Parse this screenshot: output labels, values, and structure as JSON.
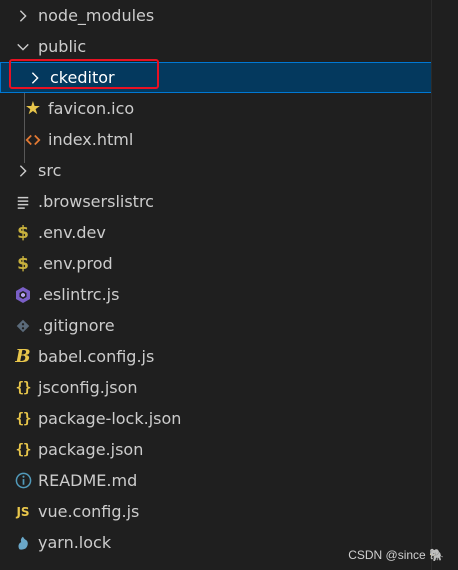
{
  "explorer": {
    "items": [
      {
        "label": "node_modules",
        "kind": "folder",
        "state": "collapsed",
        "level": 0,
        "icon": "chevron-right-icon"
      },
      {
        "label": "public",
        "kind": "folder",
        "state": "expanded",
        "level": 0,
        "icon": "chevron-down-icon"
      },
      {
        "label": "ckeditor",
        "kind": "folder",
        "state": "collapsed",
        "level": 1,
        "icon": "chevron-right-icon",
        "selected": true
      },
      {
        "label": "favicon.ico",
        "kind": "file",
        "level": 1,
        "icon": "star-icon"
      },
      {
        "label": "index.html",
        "kind": "file",
        "level": 1,
        "icon": "code-brackets-icon"
      },
      {
        "label": "src",
        "kind": "folder",
        "state": "collapsed",
        "level": 0,
        "icon": "chevron-right-icon"
      },
      {
        "label": ".browserslistrc",
        "kind": "file",
        "level": 0,
        "icon": "lines-icon"
      },
      {
        "label": ".env.dev",
        "kind": "file",
        "level": 0,
        "icon": "dollar-icon"
      },
      {
        "label": ".env.prod",
        "kind": "file",
        "level": 0,
        "icon": "dollar-icon"
      },
      {
        "label": ".eslintrc.js",
        "kind": "file",
        "level": 0,
        "icon": "eslint-icon"
      },
      {
        "label": ".gitignore",
        "kind": "file",
        "level": 0,
        "icon": "git-icon"
      },
      {
        "label": "babel.config.js",
        "kind": "file",
        "level": 0,
        "icon": "babel-icon"
      },
      {
        "label": "jsconfig.json",
        "kind": "file",
        "level": 0,
        "icon": "json-braces-icon"
      },
      {
        "label": "package-lock.json",
        "kind": "file",
        "level": 0,
        "icon": "json-braces-icon"
      },
      {
        "label": "package.json",
        "kind": "file",
        "level": 0,
        "icon": "json-braces-icon"
      },
      {
        "label": "README.md",
        "kind": "file",
        "level": 0,
        "icon": "info-icon"
      },
      {
        "label": "vue.config.js",
        "kind": "file",
        "level": 0,
        "icon": "js-icon"
      },
      {
        "label": "yarn.lock",
        "kind": "file",
        "level": 0,
        "icon": "yarn-icon"
      }
    ]
  },
  "watermark": "CSDN @since 🐘",
  "colors": {
    "background": "#1f1f1f",
    "selection": "#04395e",
    "focus_border": "#0078d4",
    "annotation_box": "#e81123"
  }
}
